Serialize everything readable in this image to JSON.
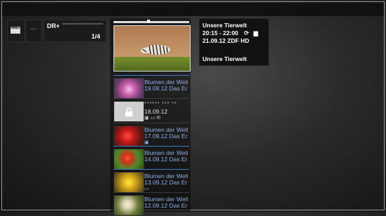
{
  "topbar": {
    "dots_label": "..."
  },
  "recording_tile": {
    "label": "DR+",
    "count": "1/4"
  },
  "hero": {
    "image": "zebra-in-savanna"
  },
  "list": [
    {
      "title": "Blumen der Welt",
      "subtitle": "19.09.12 Das Er",
      "locked": false,
      "image": "pink-flower",
      "icons": []
    },
    {
      "title": "****** *** **",
      "subtitle": "18.09.12",
      "locked": true,
      "image": "lock",
      "icons": [
        "hd-icon",
        "tv-icon",
        "mail-icon"
      ]
    },
    {
      "title": "Blumen der Welt",
      "subtitle": "17.09.12 Das Er",
      "locked": false,
      "image": "red-flower",
      "icons": [
        "hd-icon"
      ]
    },
    {
      "title": "Blumen der Welt",
      "subtitle": "14.09.12 Das Er",
      "locked": false,
      "image": "red-flower-green",
      "icons": []
    },
    {
      "title": "Blumen der Welt",
      "subtitle": "13.09.12 Das Er",
      "locked": false,
      "image": "yellow-flower",
      "icons": [
        "tv-icon"
      ]
    },
    {
      "title": "Blumen der Welt",
      "subtitle": "12.09.12 Das Er",
      "locked": false,
      "image": "white-flower",
      "icons": []
    }
  ],
  "info": {
    "title": "Unsere Tierwelt",
    "time": "20:15 - 22:00",
    "date_channel": "21.09.12  ZDF HD",
    "subtitle": "Unsere Tierwelt"
  },
  "colors": {
    "accent_blue": "#3f78c9",
    "text_blue": "#8db0e0"
  }
}
